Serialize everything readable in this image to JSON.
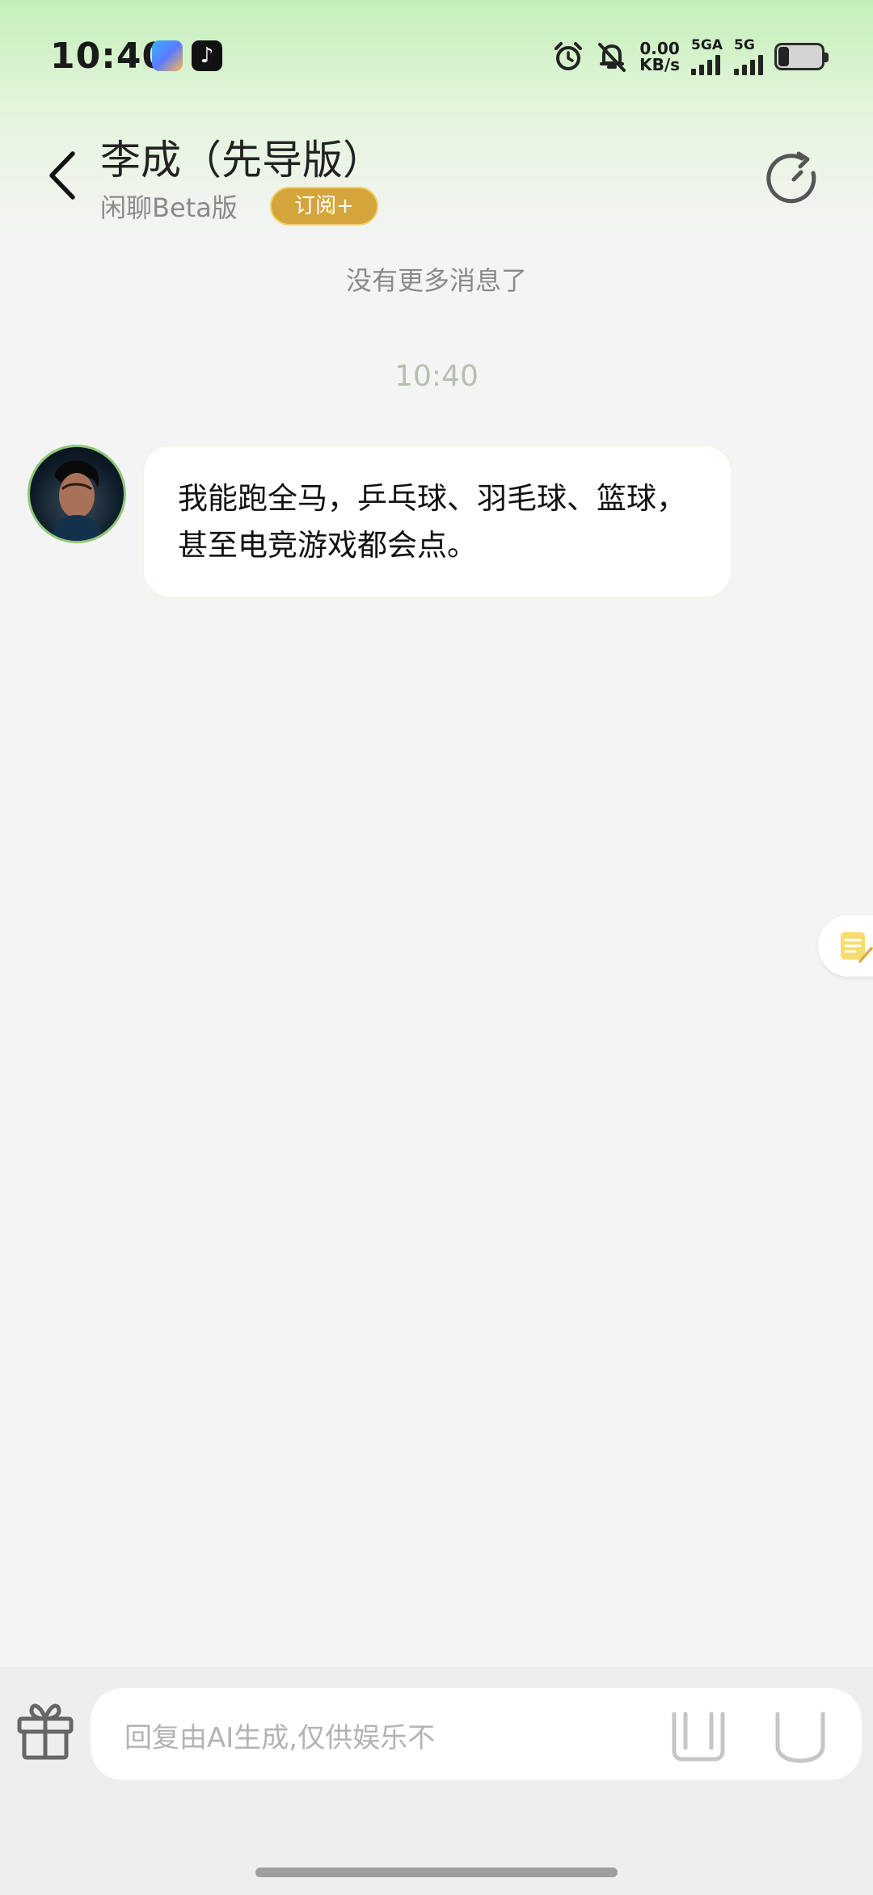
{
  "status_bar": {
    "time": "10:40",
    "net_speed_value": "0.00",
    "net_speed_unit": "KB/s",
    "signal_1_label": "5GA",
    "signal_2_label": "5G",
    "battery_level": 0.25,
    "icons": [
      "app-store-icon",
      "tiktok-icon",
      "alarm-icon",
      "mute-bell-icon"
    ]
  },
  "header": {
    "contact_name": "李成（先导版）",
    "mode_label": "闲聊Beta版",
    "subscribe_label": "订阅+",
    "accent_color": "#d4a53a"
  },
  "chat": {
    "no_more_messages": "没有更多消息了",
    "timestamp": "10:40",
    "messages": [
      {
        "sender": "李成",
        "text": "我能跑全马，乒乓球、羽毛球、篮球，甚至电竞游戏都会点。"
      }
    ]
  },
  "composer": {
    "placeholder": "回复由AI生成,仅供娱乐不"
  }
}
